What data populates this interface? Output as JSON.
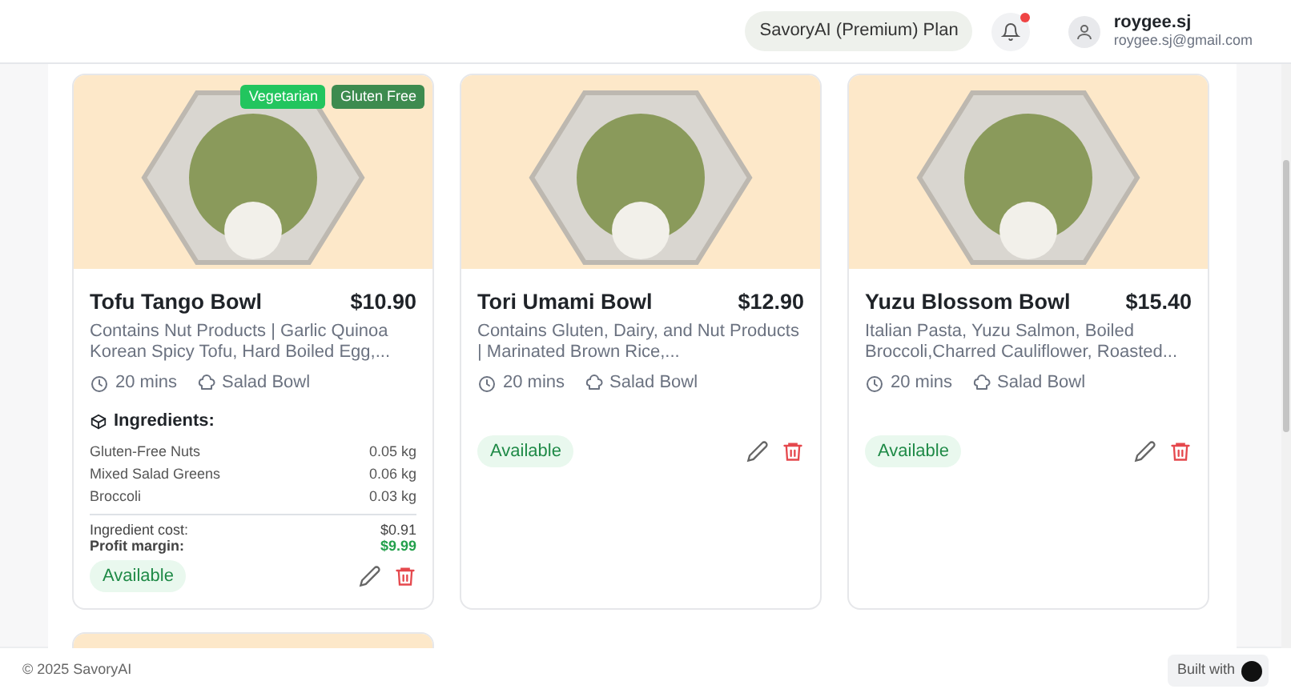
{
  "header": {
    "plan": "SavoryAI (Premium) Plan",
    "has_notification": true,
    "user": {
      "name": "roygee.sj",
      "email": "roygee.sj@gmail.com"
    }
  },
  "items": [
    {
      "name": "Tofu Tango Bowl",
      "price": "$10.90",
      "description": "Contains Nut Products | Garlic Quinoa Korean Spicy Tofu, Hard Boiled Egg,...",
      "time": "20 mins",
      "category": "Salad Bowl",
      "tags": [
        {
          "label": "Vegetarian",
          "color": "#22c55e"
        },
        {
          "label": "Gluten Free",
          "color": "#3d8b4f"
        }
      ],
      "ingredients": {
        "title": "Ingredients:",
        "rows": [
          {
            "name": "Gluten-Free Nuts",
            "qty": "0.05 kg"
          },
          {
            "name": "Mixed Salad Greens",
            "qty": "0.06 kg"
          },
          {
            "name": "Broccoli",
            "qty": "0.03 kg"
          }
        ],
        "cost_label": "Ingredient cost:",
        "cost": "$0.91",
        "margin_label": "Profit margin:",
        "margin": "$9.99"
      },
      "status": "Available"
    },
    {
      "name": "Tori Umami Bowl",
      "price": "$12.90",
      "description": "Contains Gluten, Dairy, and Nut Products | Marinated Brown Rice,...",
      "time": "20 mins",
      "category": "Salad Bowl",
      "status": "Available"
    },
    {
      "name": "Yuzu Blossom Bowl",
      "price": "$15.40",
      "description": "Italian Pasta, Yuzu Salmon, Boiled Broccoli,Charred Cauliflower, Roasted...",
      "time": "20 mins",
      "category": "Salad Bowl",
      "status": "Available"
    }
  ],
  "next_row_peek": true,
  "footer": {
    "copyright": "© 2025 SavoryAI",
    "built_with": "Built with"
  }
}
